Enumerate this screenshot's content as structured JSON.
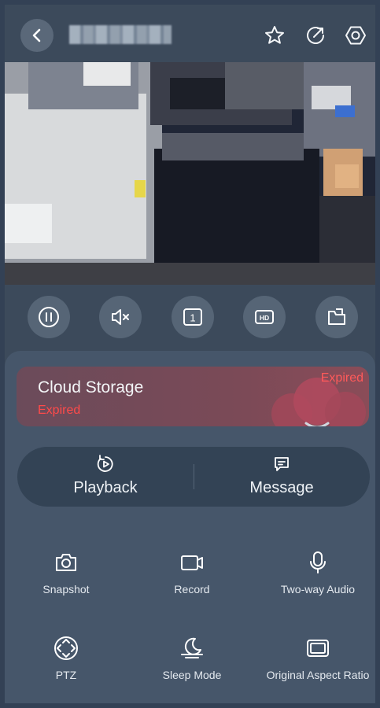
{
  "header": {
    "back_icon": "chevron-left-icon",
    "favorite_icon": "star-icon",
    "share_icon": "share-icon",
    "settings_icon": "settings-hexagon-icon"
  },
  "controls": [
    {
      "name": "pause",
      "icon": "pause-icon"
    },
    {
      "name": "mute",
      "icon": "speaker-muted-icon"
    },
    {
      "name": "split",
      "icon": "one-screen-icon",
      "text": "1"
    },
    {
      "name": "quality",
      "icon": "hd-icon",
      "text": "HD"
    },
    {
      "name": "folder",
      "icon": "folder-icon"
    }
  ],
  "cloud_storage": {
    "title": "Cloud Storage",
    "status": "Expired",
    "tag": "Expired",
    "accent": "#ff4a4a"
  },
  "playback": {
    "label": "Playback",
    "icon": "playback-icon"
  },
  "message": {
    "label": "Message",
    "icon": "message-icon"
  },
  "features": [
    {
      "label": "Snapshot",
      "icon": "camera-icon"
    },
    {
      "label": "Record",
      "icon": "video-camera-icon"
    },
    {
      "label": "Two-way Audio",
      "icon": "microphone-icon"
    },
    {
      "label": "PTZ",
      "icon": "ptz-icon"
    },
    {
      "label": "Sleep Mode",
      "icon": "sleep-icon"
    },
    {
      "label": "Original Aspect Ratio",
      "icon": "aspect-ratio-icon"
    }
  ]
}
